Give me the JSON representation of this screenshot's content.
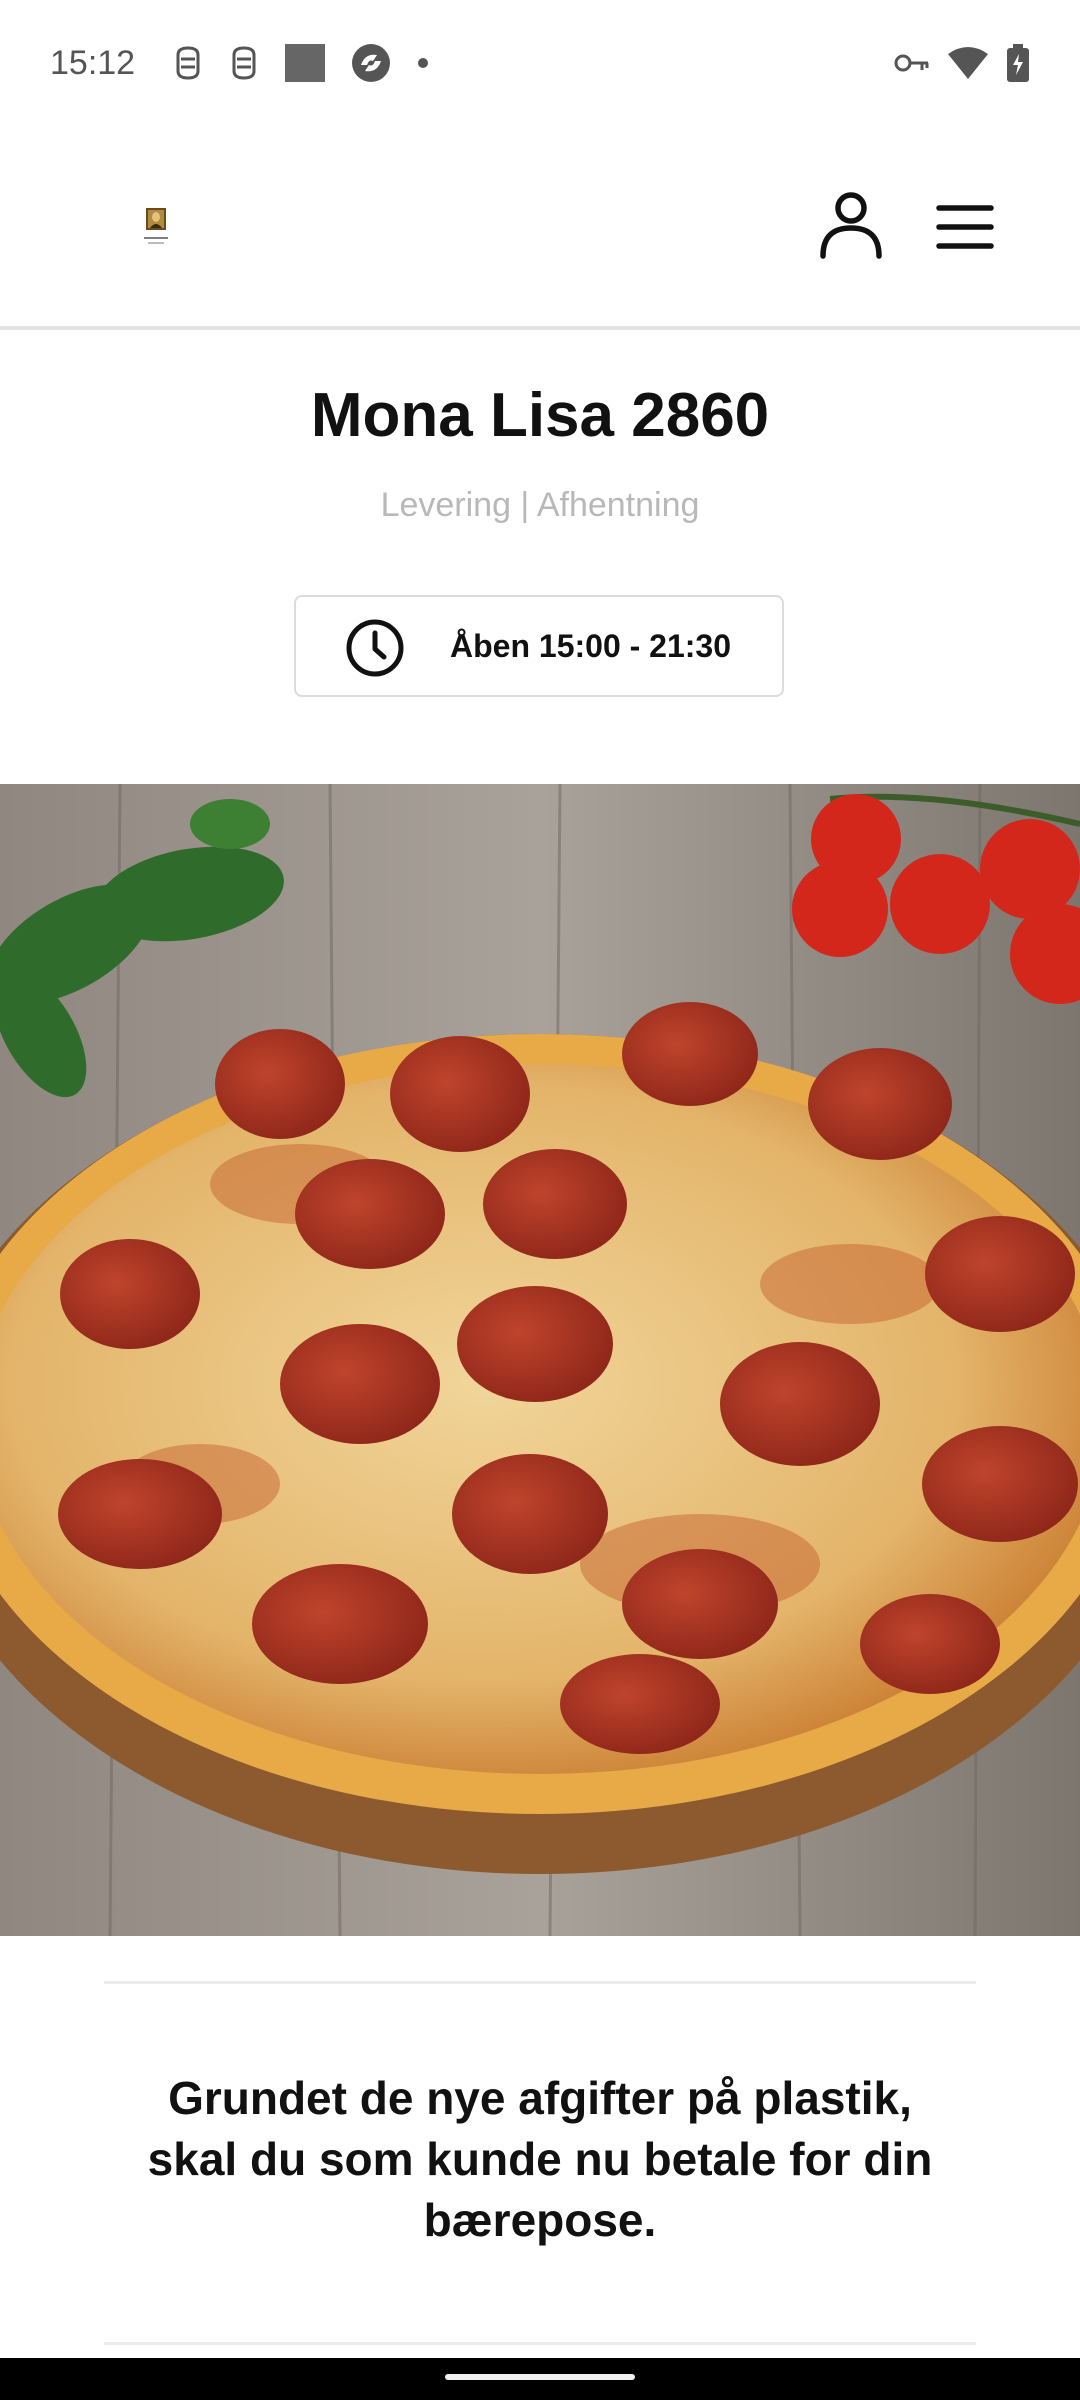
{
  "status_bar": {
    "time": "15:12",
    "left_icons": [
      "notification-icon",
      "notification-icon",
      "square-icon",
      "app-icon",
      "dot-icon"
    ],
    "right_icons": [
      "vpn-key-icon",
      "wifi-icon",
      "battery-charging-icon"
    ]
  },
  "header": {
    "logo": "restaurant-logo",
    "user_icon": "user-icon",
    "menu_icon": "hamburger-menu-icon"
  },
  "restaurant": {
    "name": "Mona Lisa 2860",
    "service_types": "Levering | Afhentning",
    "hours": "Åben 15:00 - 21:30"
  },
  "hero": {
    "image": "pepperoni-pizza-photo"
  },
  "notice": {
    "text": "Grundet de nye afgifter på plastik, skal du som kunde nu betale for din bærepose."
  },
  "colors": {
    "text": "#111111",
    "muted": "#b8b8b8",
    "border": "#dcdcdc"
  }
}
